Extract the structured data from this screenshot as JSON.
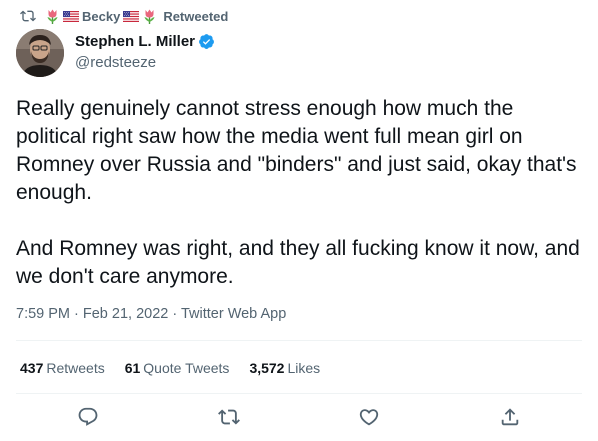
{
  "retweet_context": {
    "name_part": "Becky",
    "label": "Retweeted",
    "icon": "retweet-icon",
    "emoji": [
      "tulip",
      "us-flag",
      "us-flag",
      "tulip"
    ]
  },
  "author": {
    "name": "Stephen L. Miller",
    "handle": "@redsteeze",
    "verified": true,
    "avatar": "avatar"
  },
  "tweet": {
    "paragraphs": [
      "Really genuinely cannot stress enough how much the political right saw how the media went full mean girl on Romney over Russia and \"binders\" and just said, okay that's enough.",
      "And Romney was right, and they all fucking know it now, and we don't care anymore."
    ]
  },
  "meta": {
    "line": "7:59 PM · Feb 21, 2022 · Twitter Web App"
  },
  "stats": {
    "retweets_num": "437",
    "retweets_label": "Retweets",
    "quotes_num": "61",
    "quotes_label": "Quote Tweets",
    "likes_num": "3,572",
    "likes_label": "Likes"
  },
  "actions": [
    "reply-icon",
    "retweet-icon",
    "heart-icon",
    "share-icon"
  ],
  "colors": {
    "text": "#0f1419",
    "secondary": "#536471",
    "verified": "#1d9bf0",
    "divider": "#eff3f4"
  }
}
